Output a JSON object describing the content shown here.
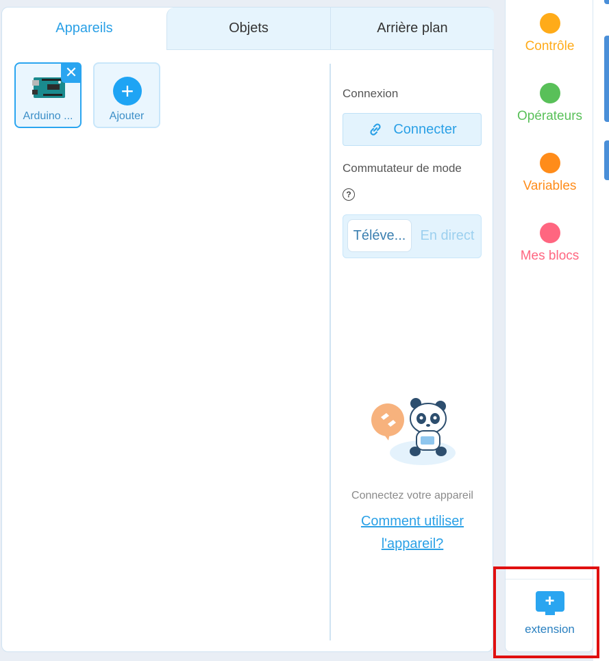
{
  "tabs": [
    {
      "label": "Appareils",
      "active": true
    },
    {
      "label": "Objets",
      "active": false
    },
    {
      "label": "Arrière plan",
      "active": false
    }
  ],
  "devices": {
    "arduino_label": "Arduino ...",
    "close_glyph": "✕",
    "add_label": "Ajouter",
    "add_glyph": "+"
  },
  "device_panel": {
    "connection_label": "Connexion",
    "connect_button": "Connecter",
    "mode_switch_label": "Commutateur de mode",
    "help_glyph": "?",
    "mode_upload": "Téléve...",
    "mode_live": "En direct",
    "connect_hint": "Connectez votre appareil",
    "howto_link": "Comment utiliser l'appareil?"
  },
  "categories": [
    {
      "label": "Contrôle",
      "color": "#ffab19"
    },
    {
      "label": "Opérateurs",
      "color": "#59c059"
    },
    {
      "label": "Variables",
      "color": "#ff8c1a"
    },
    {
      "label": "Mes blocs",
      "color": "#ff6680"
    }
  ],
  "extension": {
    "label": "extension",
    "glyph": "+"
  },
  "colors": {
    "accent": "#2aa0e6",
    "highlight_box": "#e01010"
  }
}
